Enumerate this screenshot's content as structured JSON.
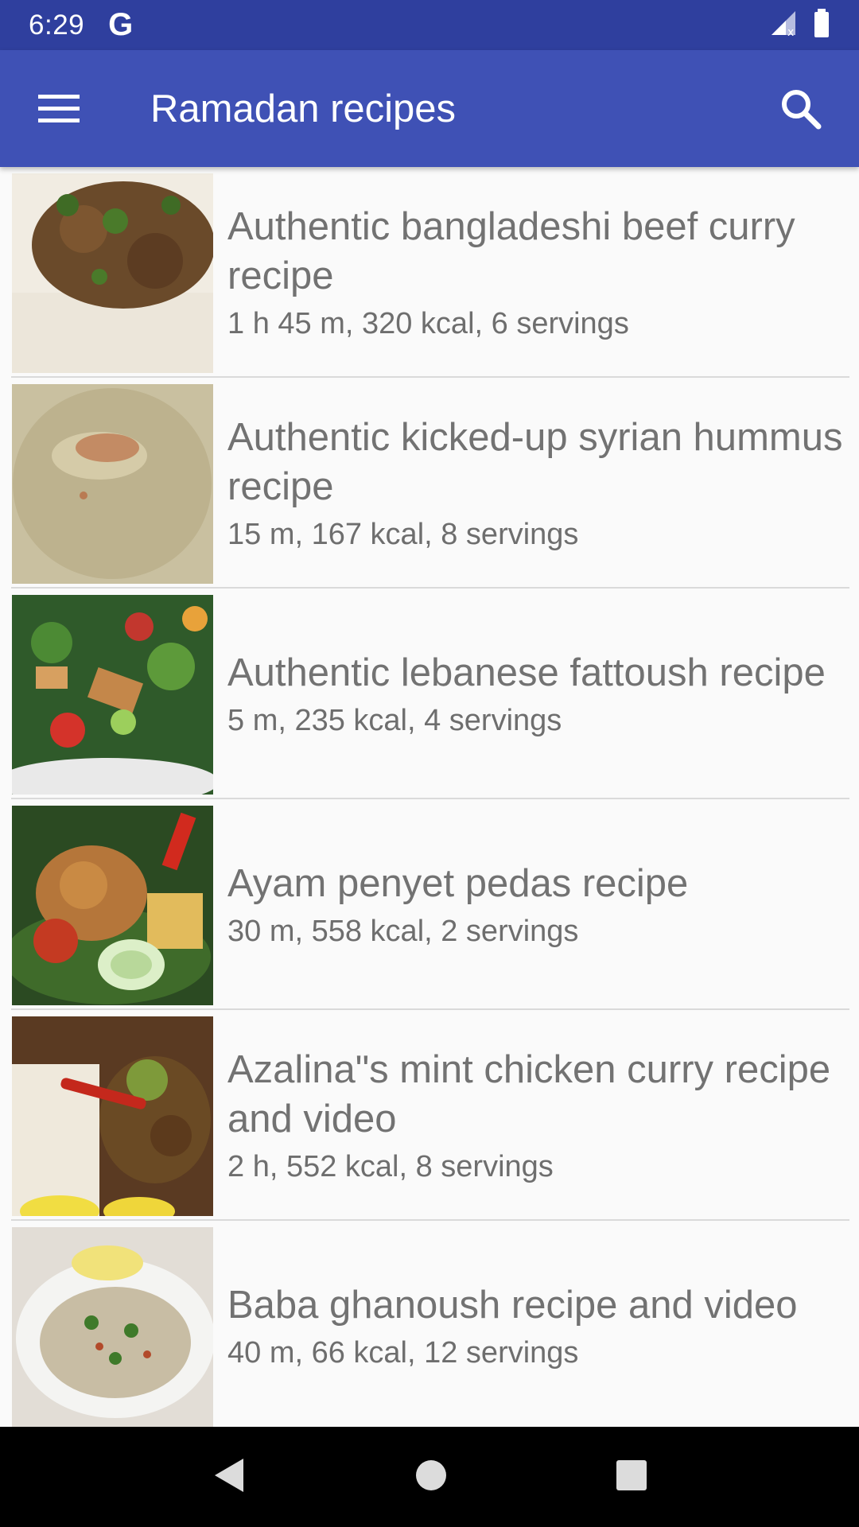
{
  "status_bar": {
    "time": "6:29",
    "carrier_glyph": "G"
  },
  "app_bar": {
    "title": "Ramadan recipes"
  },
  "recipes": [
    {
      "title": "Authentic bangladeshi beef curry recipe",
      "meta": "1 h 45 m, 320 kcal, 6 servings"
    },
    {
      "title": "Authentic kicked-up syrian hummus recipe",
      "meta": "15 m, 167 kcal, 8 servings"
    },
    {
      "title": "Authentic lebanese fattoush recipe",
      "meta": "5 m, 235 kcal, 4 servings"
    },
    {
      "title": "Ayam penyet pedas  recipe",
      "meta": "30 m, 558 kcal, 2 servings"
    },
    {
      "title": "Azalina\"s mint chicken curry recipe and video",
      "meta": "2 h, 552 kcal, 8 servings"
    },
    {
      "title": "Baba ghanoush recipe and video",
      "meta": "40 m, 66 kcal, 12 servings"
    }
  ],
  "icons": {
    "menu": "hamburger-menu-icon",
    "search": "search-icon",
    "back": "back-triangle-icon",
    "home": "home-circle-icon",
    "recents": "recents-square-icon"
  },
  "colors": {
    "status_bar": "#2f3f9e",
    "app_bar": "#3f51b5",
    "text_primary": "#727272"
  }
}
